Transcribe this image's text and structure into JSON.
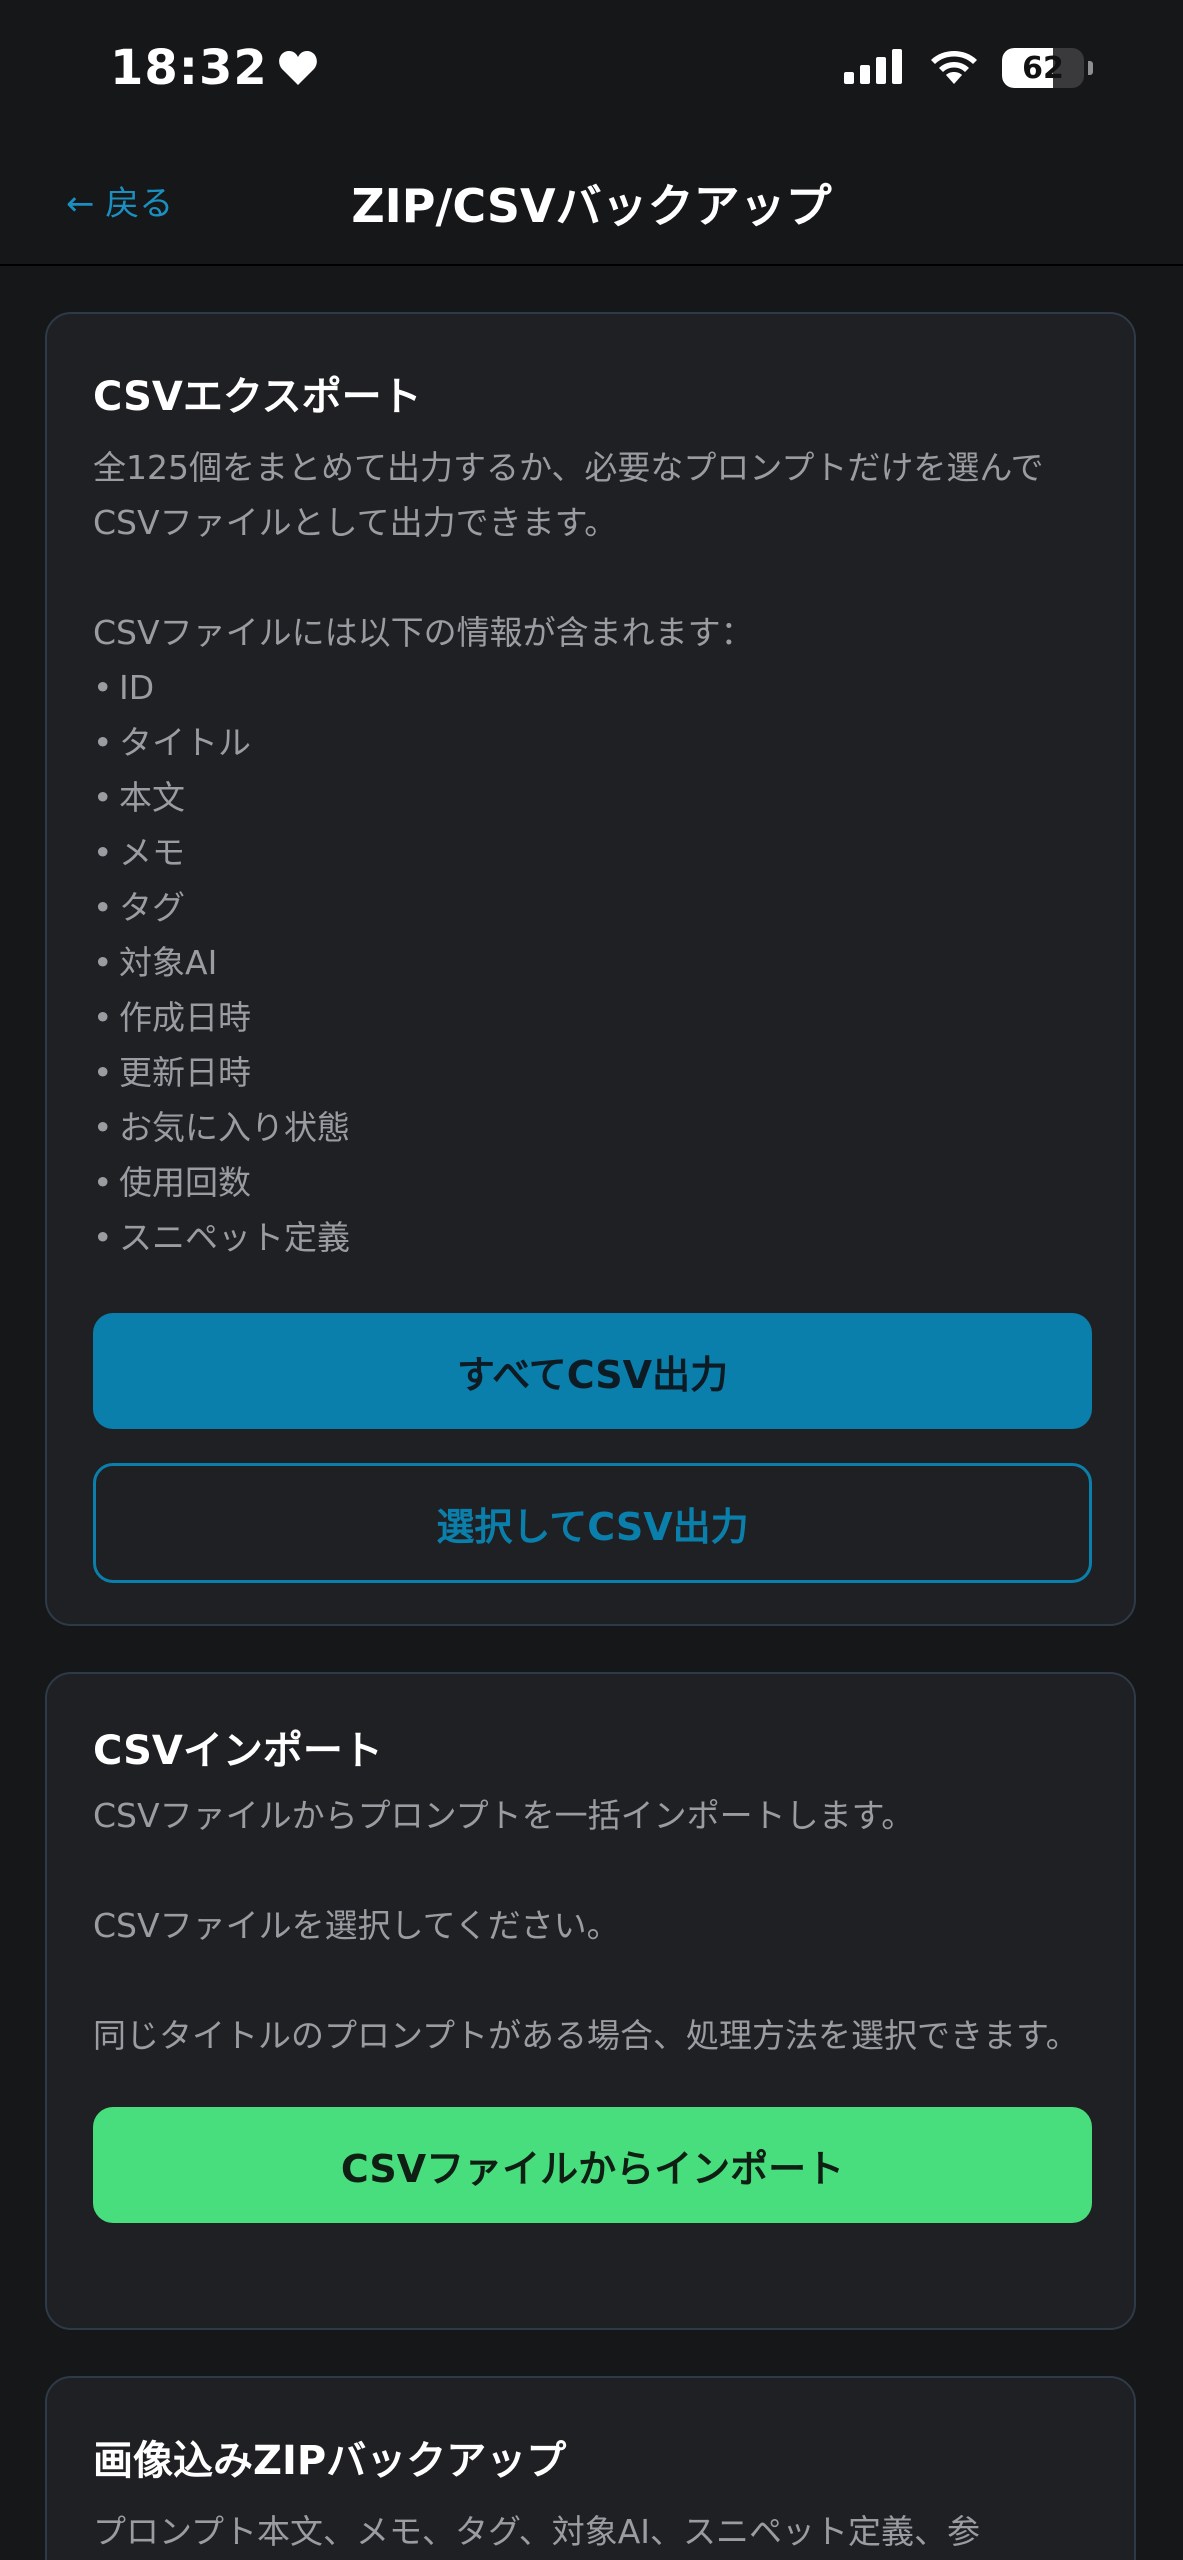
{
  "status_bar": {
    "time": "18:32",
    "battery_level": "62",
    "battery_fraction": 0.62
  },
  "header": {
    "back_label": "← 戻る",
    "title": "ZIP/CSVバックアップ"
  },
  "csv_export": {
    "title": "CSVエクスポート",
    "description": "全125個をまとめて出力するか、必要なプロンプトだけを選んでCSVファイルとして出力できます。",
    "fields_intro": "CSVファイルには以下の情報が含まれます：",
    "fields": [
      "ID",
      "タイトル",
      "本文",
      "メモ",
      "タグ",
      "対象AI",
      "作成日時",
      "更新日時",
      "お気に入り状態",
      "使用回数",
      "スニペット定義"
    ],
    "export_all_label": "すべてCSV出力",
    "export_selected_label": "選択してCSV出力"
  },
  "csv_import": {
    "title": "CSVインポート",
    "description": "CSVファイルからプロンプトを一括インポートします。",
    "instruction": "CSVファイルを選択してください。",
    "note": "同じタイトルのプロンプトがある場合、処理方法を選択できます。",
    "import_label": "CSVファイルからインポート"
  },
  "zip_backup": {
    "title": "画像込みZIPバックアップ",
    "description": "プロンプト本文、メモ、タグ、対象AI、スニペット定義、参"
  },
  "colors": {
    "background": "#161719",
    "card": "#1f2023",
    "card_border": "#2f3a48",
    "accent_blue": "#0b7fab",
    "link_blue": "#1a8fc0",
    "accent_green": "#49de7d",
    "muted_text": "#9a9ca1"
  }
}
